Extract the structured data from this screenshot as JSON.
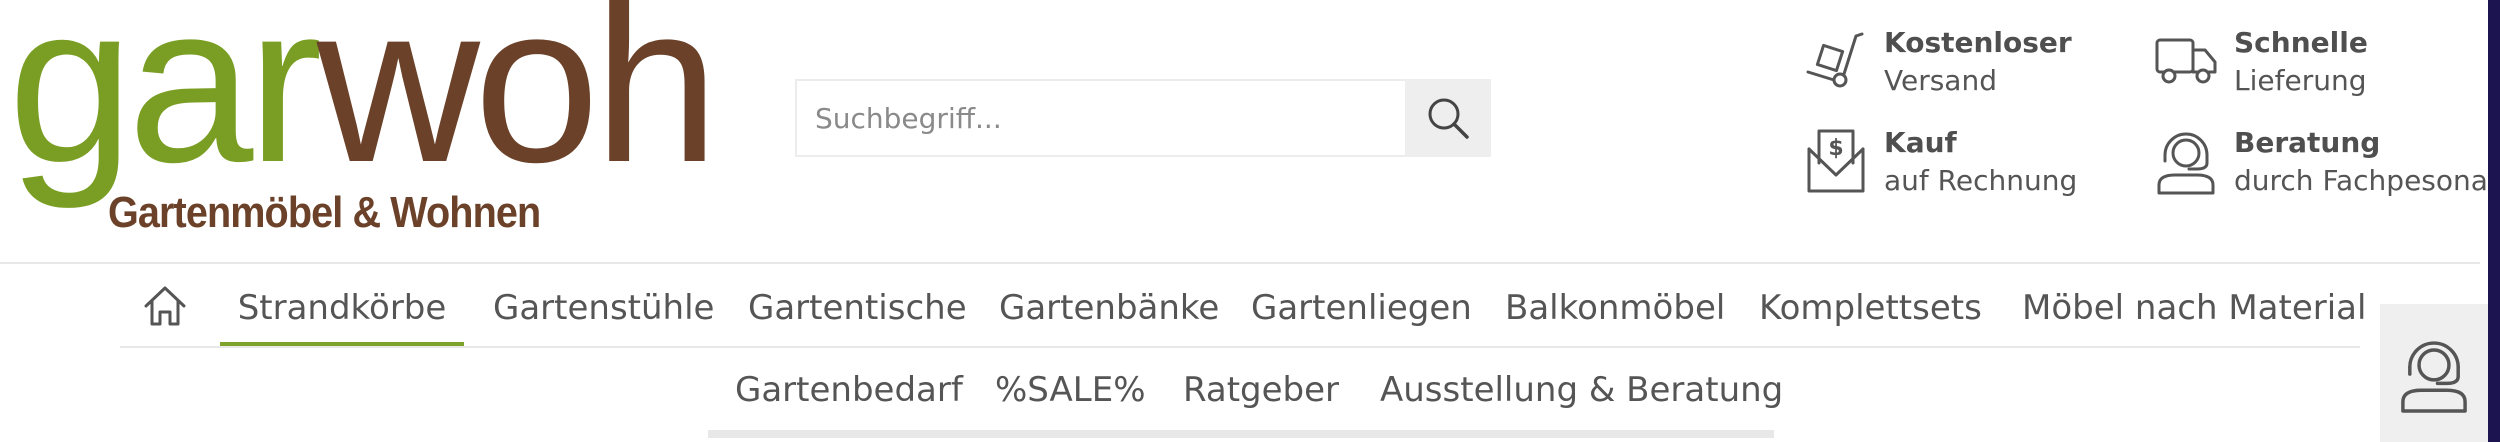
{
  "logo": {
    "word_part1": "gar",
    "word_part2": "woh",
    "tagline": "Gartenmöbel & Wohnen"
  },
  "search": {
    "placeholder": "Suchbegriff..."
  },
  "services": [
    {
      "title": "Kostenloser",
      "subtitle": "Versand",
      "icon": "hand-truck-icon"
    },
    {
      "title": "Schnelle",
      "subtitle": "Lieferung",
      "icon": "delivery-truck-icon"
    },
    {
      "title": "Kauf",
      "subtitle": "auf Rechnung",
      "icon": "invoice-dollar-icon"
    },
    {
      "title": "Beratung",
      "subtitle": "durch Fachpesonal",
      "icon": "headset-icon"
    }
  ],
  "nav": {
    "row1": [
      "Strandkörbe",
      "Gartenstühle",
      "Gartentische",
      "Gartenbänke",
      "Gartenliegen",
      "Balkonmöbel",
      "Komplettsets",
      "Möbel nach Material"
    ],
    "row2": [
      "Gartenbedarf",
      "%SALE%",
      "Ratgeber",
      "Ausstellung & Beratung"
    ],
    "active": "Strandkörbe"
  },
  "colors": {
    "brand_green": "#7a9e23",
    "brand_brown": "#6b4229",
    "active_underline": "#7ea32a",
    "side_strip": "#1b1450"
  }
}
